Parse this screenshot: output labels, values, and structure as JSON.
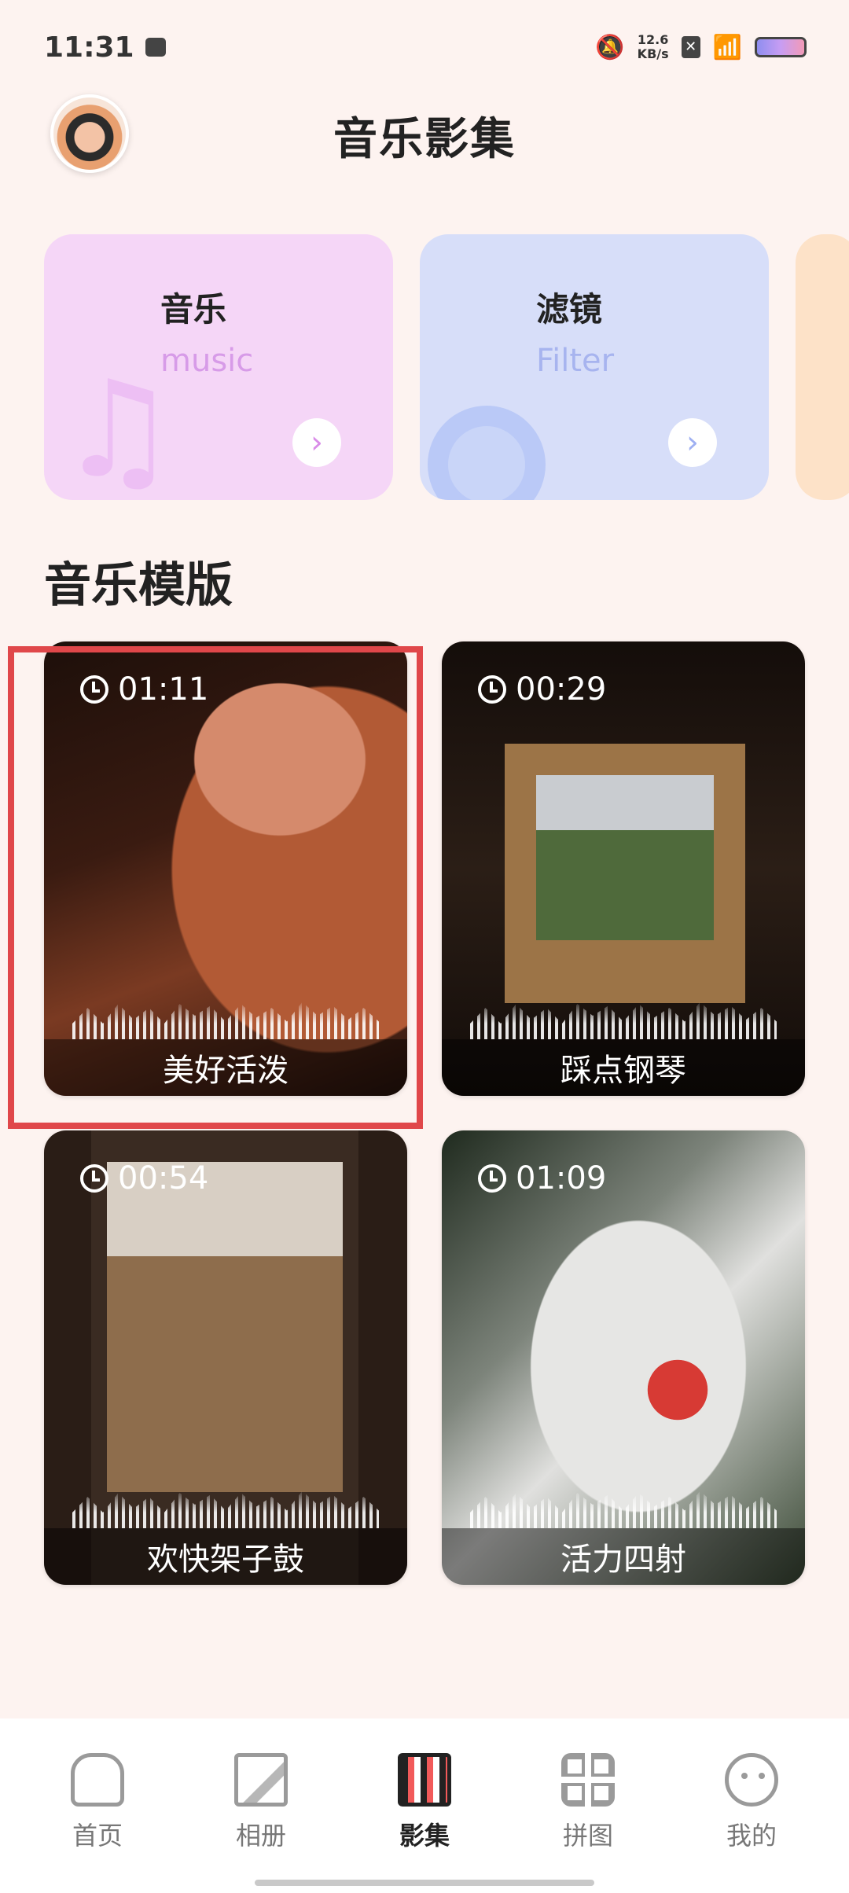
{
  "status_bar": {
    "time": "11:31",
    "net_speed_value": "12.6",
    "net_speed_unit": "KB/s",
    "icons": [
      "mute-icon",
      "no-sim-icon",
      "wifi-icon",
      "battery-icon"
    ]
  },
  "header": {
    "title": "音乐影集"
  },
  "features": [
    {
      "title": "音乐",
      "subtitle": "music",
      "icon": "music-note-icon",
      "accent": "#f5d6f7"
    },
    {
      "title": "滤镜",
      "subtitle": "Filter",
      "icon": "filter-icon",
      "accent": "#d7def9"
    }
  ],
  "section": {
    "title": "音乐模版"
  },
  "templates": [
    {
      "duration": "01:11",
      "label": "美好活泼"
    },
    {
      "duration": "00:29",
      "label": "踩点钢琴"
    },
    {
      "duration": "00:54",
      "label": "欢快架子鼓"
    },
    {
      "duration": "01:09",
      "label": "活力四射"
    }
  ],
  "bottom_nav": [
    {
      "label": "首页",
      "icon": "home-icon",
      "active": false
    },
    {
      "label": "相册",
      "icon": "album-icon",
      "active": false
    },
    {
      "label": "影集",
      "icon": "film-reel-icon",
      "active": true
    },
    {
      "label": "拼图",
      "icon": "puzzle-grid-icon",
      "active": false
    },
    {
      "label": "我的",
      "icon": "profile-icon",
      "active": false
    }
  ]
}
